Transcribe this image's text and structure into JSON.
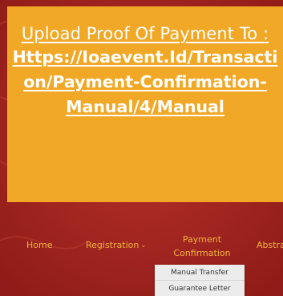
{
  "banner": {
    "line1": "Upload Proof Of Payment To :",
    "line2": "Https://Ioaevent.Id/Transacti",
    "line3": "on/Payment-Confirmation-",
    "line4": "Manual/4/Manual"
  },
  "nav": {
    "home": "Home",
    "registration": "Registration",
    "payment_line1": "Payment",
    "payment_line2": "Confirmation",
    "abstract": "Abstra",
    "chevron": "⌄"
  },
  "dropdown": {
    "items": [
      "Manual Transfer",
      "Guarantee Letter"
    ]
  },
  "colors": {
    "background": "#a92420",
    "banner": "#f0a826",
    "nav_text": "#f1b23c"
  }
}
